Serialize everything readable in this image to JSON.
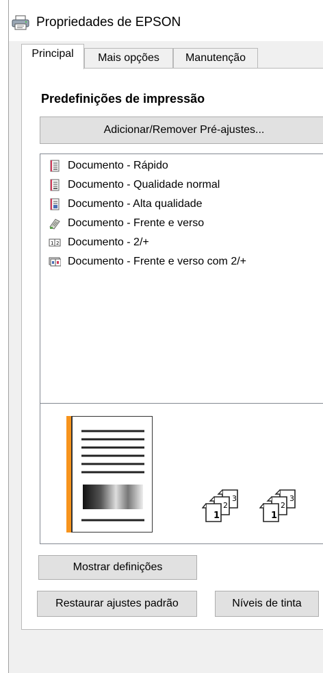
{
  "window": {
    "title": "Propriedades de EPSON",
    "icon": "printer-icon"
  },
  "tabs": [
    {
      "label": "Principal",
      "active": true
    },
    {
      "label": "Mais opções",
      "active": false
    },
    {
      "label": "Manutenção",
      "active": false
    }
  ],
  "presets": {
    "section_title": "Predefinições de impressão",
    "add_remove_button": "Adicionar/Remover Pré-ajustes...",
    "items": [
      {
        "label": "Documento - Rápido",
        "icon": "document-fast-icon"
      },
      {
        "label": "Documento - Qualidade normal",
        "icon": "document-normal-icon"
      },
      {
        "label": "Documento - Alta qualidade",
        "icon": "document-high-quality-icon"
      },
      {
        "label": "Documento - Frente e verso",
        "icon": "document-duplex-icon"
      },
      {
        "label": "Documento - 2/+",
        "icon": "document-2up-icon"
      },
      {
        "label": "Documento - Frente e verso com 2/+",
        "icon": "document-duplex-2up-icon"
      }
    ]
  },
  "preview": {
    "page_icon": "page-preview-icon",
    "copies_icons": [
      "collated-copies-icon",
      "collated-copies-icon"
    ],
    "copy_numbers": [
      "1",
      "2",
      "3"
    ],
    "accent_color": "#f7941d"
  },
  "buttons": {
    "show_settings": "Mostrar definições",
    "restore_defaults": "Restaurar ajustes padrão",
    "ink_levels": "Níveis de tinta"
  }
}
